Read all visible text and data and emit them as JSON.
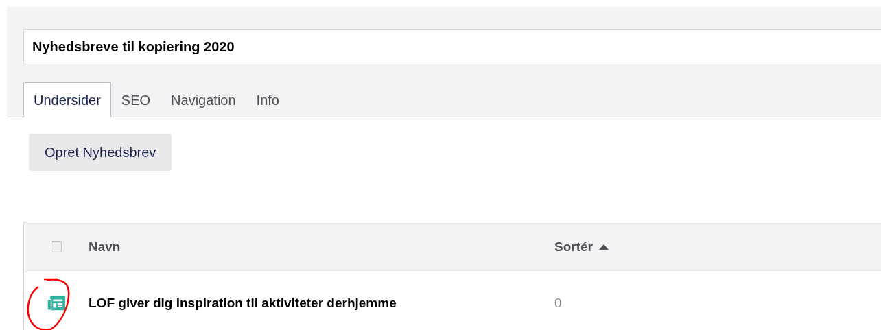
{
  "title_field": {
    "value": "Nyhedsbreve til kopiering 2020"
  },
  "tabs": [
    {
      "label": "Undersider",
      "selected": true
    },
    {
      "label": "SEO",
      "selected": false
    },
    {
      "label": "Navigation",
      "selected": false
    },
    {
      "label": "Info",
      "selected": false
    }
  ],
  "create_button": {
    "label": "Opret Nyhedsbrev"
  },
  "table": {
    "select_all": {
      "checked": false
    },
    "columns": [
      {
        "label": "Navn",
        "sorted": false
      },
      {
        "label": "Sortér",
        "sorted": true
      }
    ],
    "rows": [
      {
        "name": "LOF giver dig inspiration til aktiviteter derhjemme",
        "sort_value": "0",
        "kind": "newsletter"
      }
    ]
  },
  "annotation": {
    "kind": "circle"
  }
}
